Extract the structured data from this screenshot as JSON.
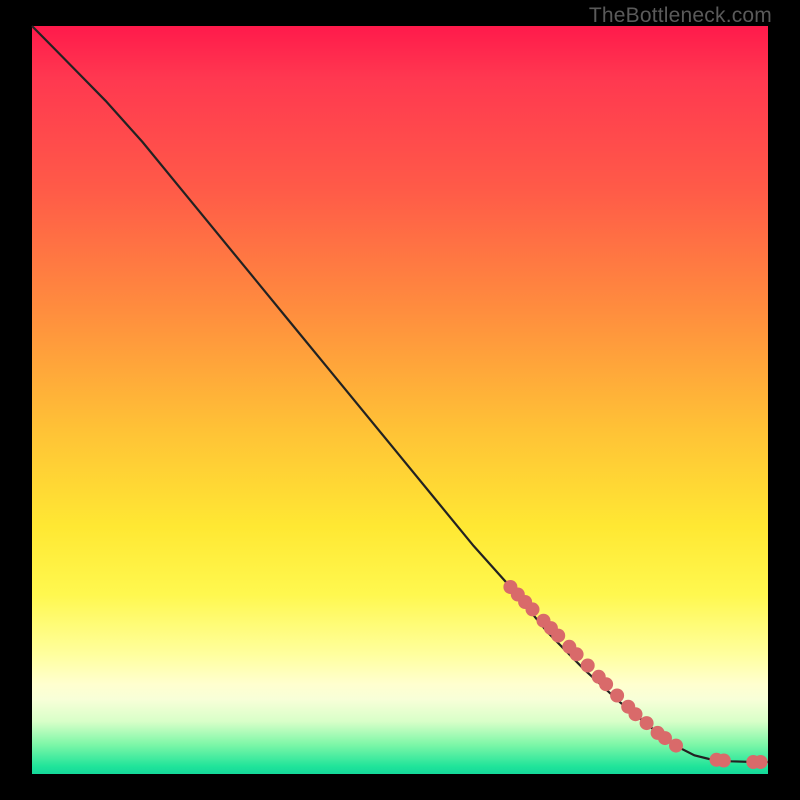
{
  "watermark": "TheBottleneck.com",
  "colors": {
    "background": "#000000",
    "curve_stroke": "#222222",
    "marker_fill": "#d96a6a",
    "marker_stroke": "#c45a5a"
  },
  "chart_data": {
    "type": "line",
    "title": "",
    "xlabel": "",
    "ylabel": "",
    "xlim": [
      0,
      100
    ],
    "ylim": [
      0,
      100
    ],
    "grid": false,
    "series": [
      {
        "name": "curve",
        "x": [
          0,
          3,
          6,
          10,
          15,
          20,
          25,
          30,
          35,
          40,
          45,
          50,
          55,
          60,
          65,
          70,
          75,
          80,
          85,
          88,
          90,
          92,
          95,
          98,
          100
        ],
        "y": [
          100,
          97,
          94,
          90,
          84.5,
          78.5,
          72.5,
          66.5,
          60.5,
          54.5,
          48.5,
          42.5,
          36.5,
          30.5,
          25,
          19,
          14,
          9.5,
          5.5,
          3.5,
          2.5,
          2.0,
          1.7,
          1.6,
          1.6
        ]
      }
    ],
    "markers": [
      {
        "x": 65.0,
        "y": 25.0
      },
      {
        "x": 66.0,
        "y": 24.0
      },
      {
        "x": 67.0,
        "y": 23.0
      },
      {
        "x": 68.0,
        "y": 22.0
      },
      {
        "x": 69.5,
        "y": 20.5
      },
      {
        "x": 70.5,
        "y": 19.5
      },
      {
        "x": 71.5,
        "y": 18.5
      },
      {
        "x": 73.0,
        "y": 17.0
      },
      {
        "x": 74.0,
        "y": 16.0
      },
      {
        "x": 75.5,
        "y": 14.5
      },
      {
        "x": 77.0,
        "y": 13.0
      },
      {
        "x": 78.0,
        "y": 12.0
      },
      {
        "x": 79.5,
        "y": 10.5
      },
      {
        "x": 81.0,
        "y": 9.0
      },
      {
        "x": 82.0,
        "y": 8.0
      },
      {
        "x": 83.5,
        "y": 6.8
      },
      {
        "x": 85.0,
        "y": 5.5
      },
      {
        "x": 86.0,
        "y": 4.8
      },
      {
        "x": 87.5,
        "y": 3.8
      },
      {
        "x": 93.0,
        "y": 1.9
      },
      {
        "x": 94.0,
        "y": 1.8
      },
      {
        "x": 98.0,
        "y": 1.6
      },
      {
        "x": 99.0,
        "y": 1.6
      }
    ]
  }
}
